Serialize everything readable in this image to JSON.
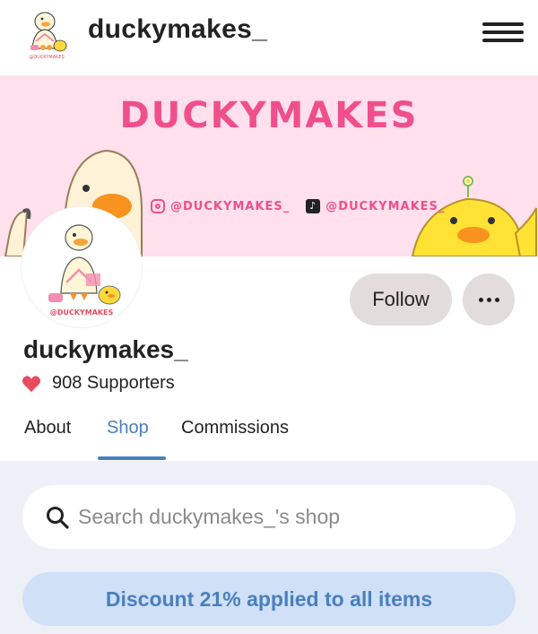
{
  "header": {
    "brand": "duckymakes_"
  },
  "banner": {
    "title": "DUCKYMAKES",
    "instagram_handle": "@DUCKYMAKES_",
    "tiktok_handle": "@DUCKYMAKES_"
  },
  "profile": {
    "avatar_caption": "@DUCKYMAKES",
    "username": "duckymakes_",
    "supporters": "908 Supporters",
    "follow_label": "Follow"
  },
  "tabs": [
    {
      "label": "About",
      "active": false
    },
    {
      "label": "Shop",
      "active": true
    },
    {
      "label": "Commissions",
      "active": false
    }
  ],
  "shop": {
    "search_placeholder": "Search duckymakes_'s shop",
    "discount_text": "Discount 21% applied to all items"
  },
  "colors": {
    "accent": "#4a7fbd",
    "banner_pink": "#ffe0ec",
    "banner_text": "#ef4f8b",
    "button_bg": "#e3dcdc",
    "heart": "#e84a5f"
  },
  "icons": [
    "hamburger-icon",
    "instagram-icon",
    "tiktok-icon",
    "heart-icon",
    "more-dots-icon",
    "search-icon"
  ]
}
